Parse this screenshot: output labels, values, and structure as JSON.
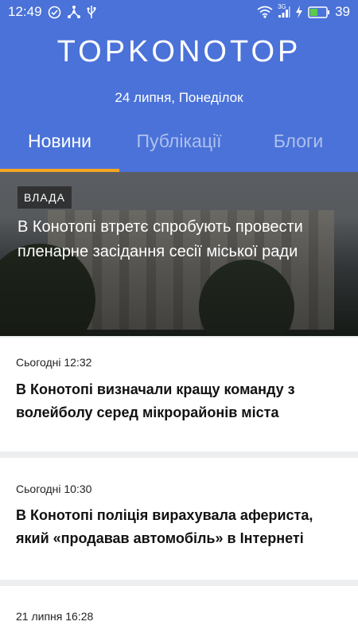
{
  "status_bar": {
    "time": "12:49",
    "left_icons": [
      "check-circle-icon",
      "nodes-icon",
      "usb-icon"
    ],
    "right_icons": [
      "wifi-icon",
      "signal-icon",
      "charging-icon",
      "battery-icon"
    ],
    "network_label": "3G",
    "battery_level": "39"
  },
  "header": {
    "logo": "TOPKONOTOP",
    "date": "24 липня, Понеділок",
    "background_color": "#4a72d8",
    "accent_color": "#f5a623"
  },
  "tabs": [
    {
      "label": "Новини",
      "active": true
    },
    {
      "label": "Публікації",
      "active": false
    },
    {
      "label": "Блоги",
      "active": false
    }
  ],
  "hero": {
    "category": "ВЛАДА",
    "title": "В Конотопі втретє спробують провести пленарне засідання сесії міської ради"
  },
  "news": [
    {
      "time": "Сьогодні 12:32",
      "title": "В Конотопі визначали кращу команду з волейболу серед мікрорайонів міста"
    },
    {
      "time": "Сьогодні 10:30",
      "title": "В Конотопі поліція вирахувала афериста, який «продавав автомобіль» в Інтернеті"
    },
    {
      "time": "21 липня 16:28",
      "title": ""
    }
  ]
}
